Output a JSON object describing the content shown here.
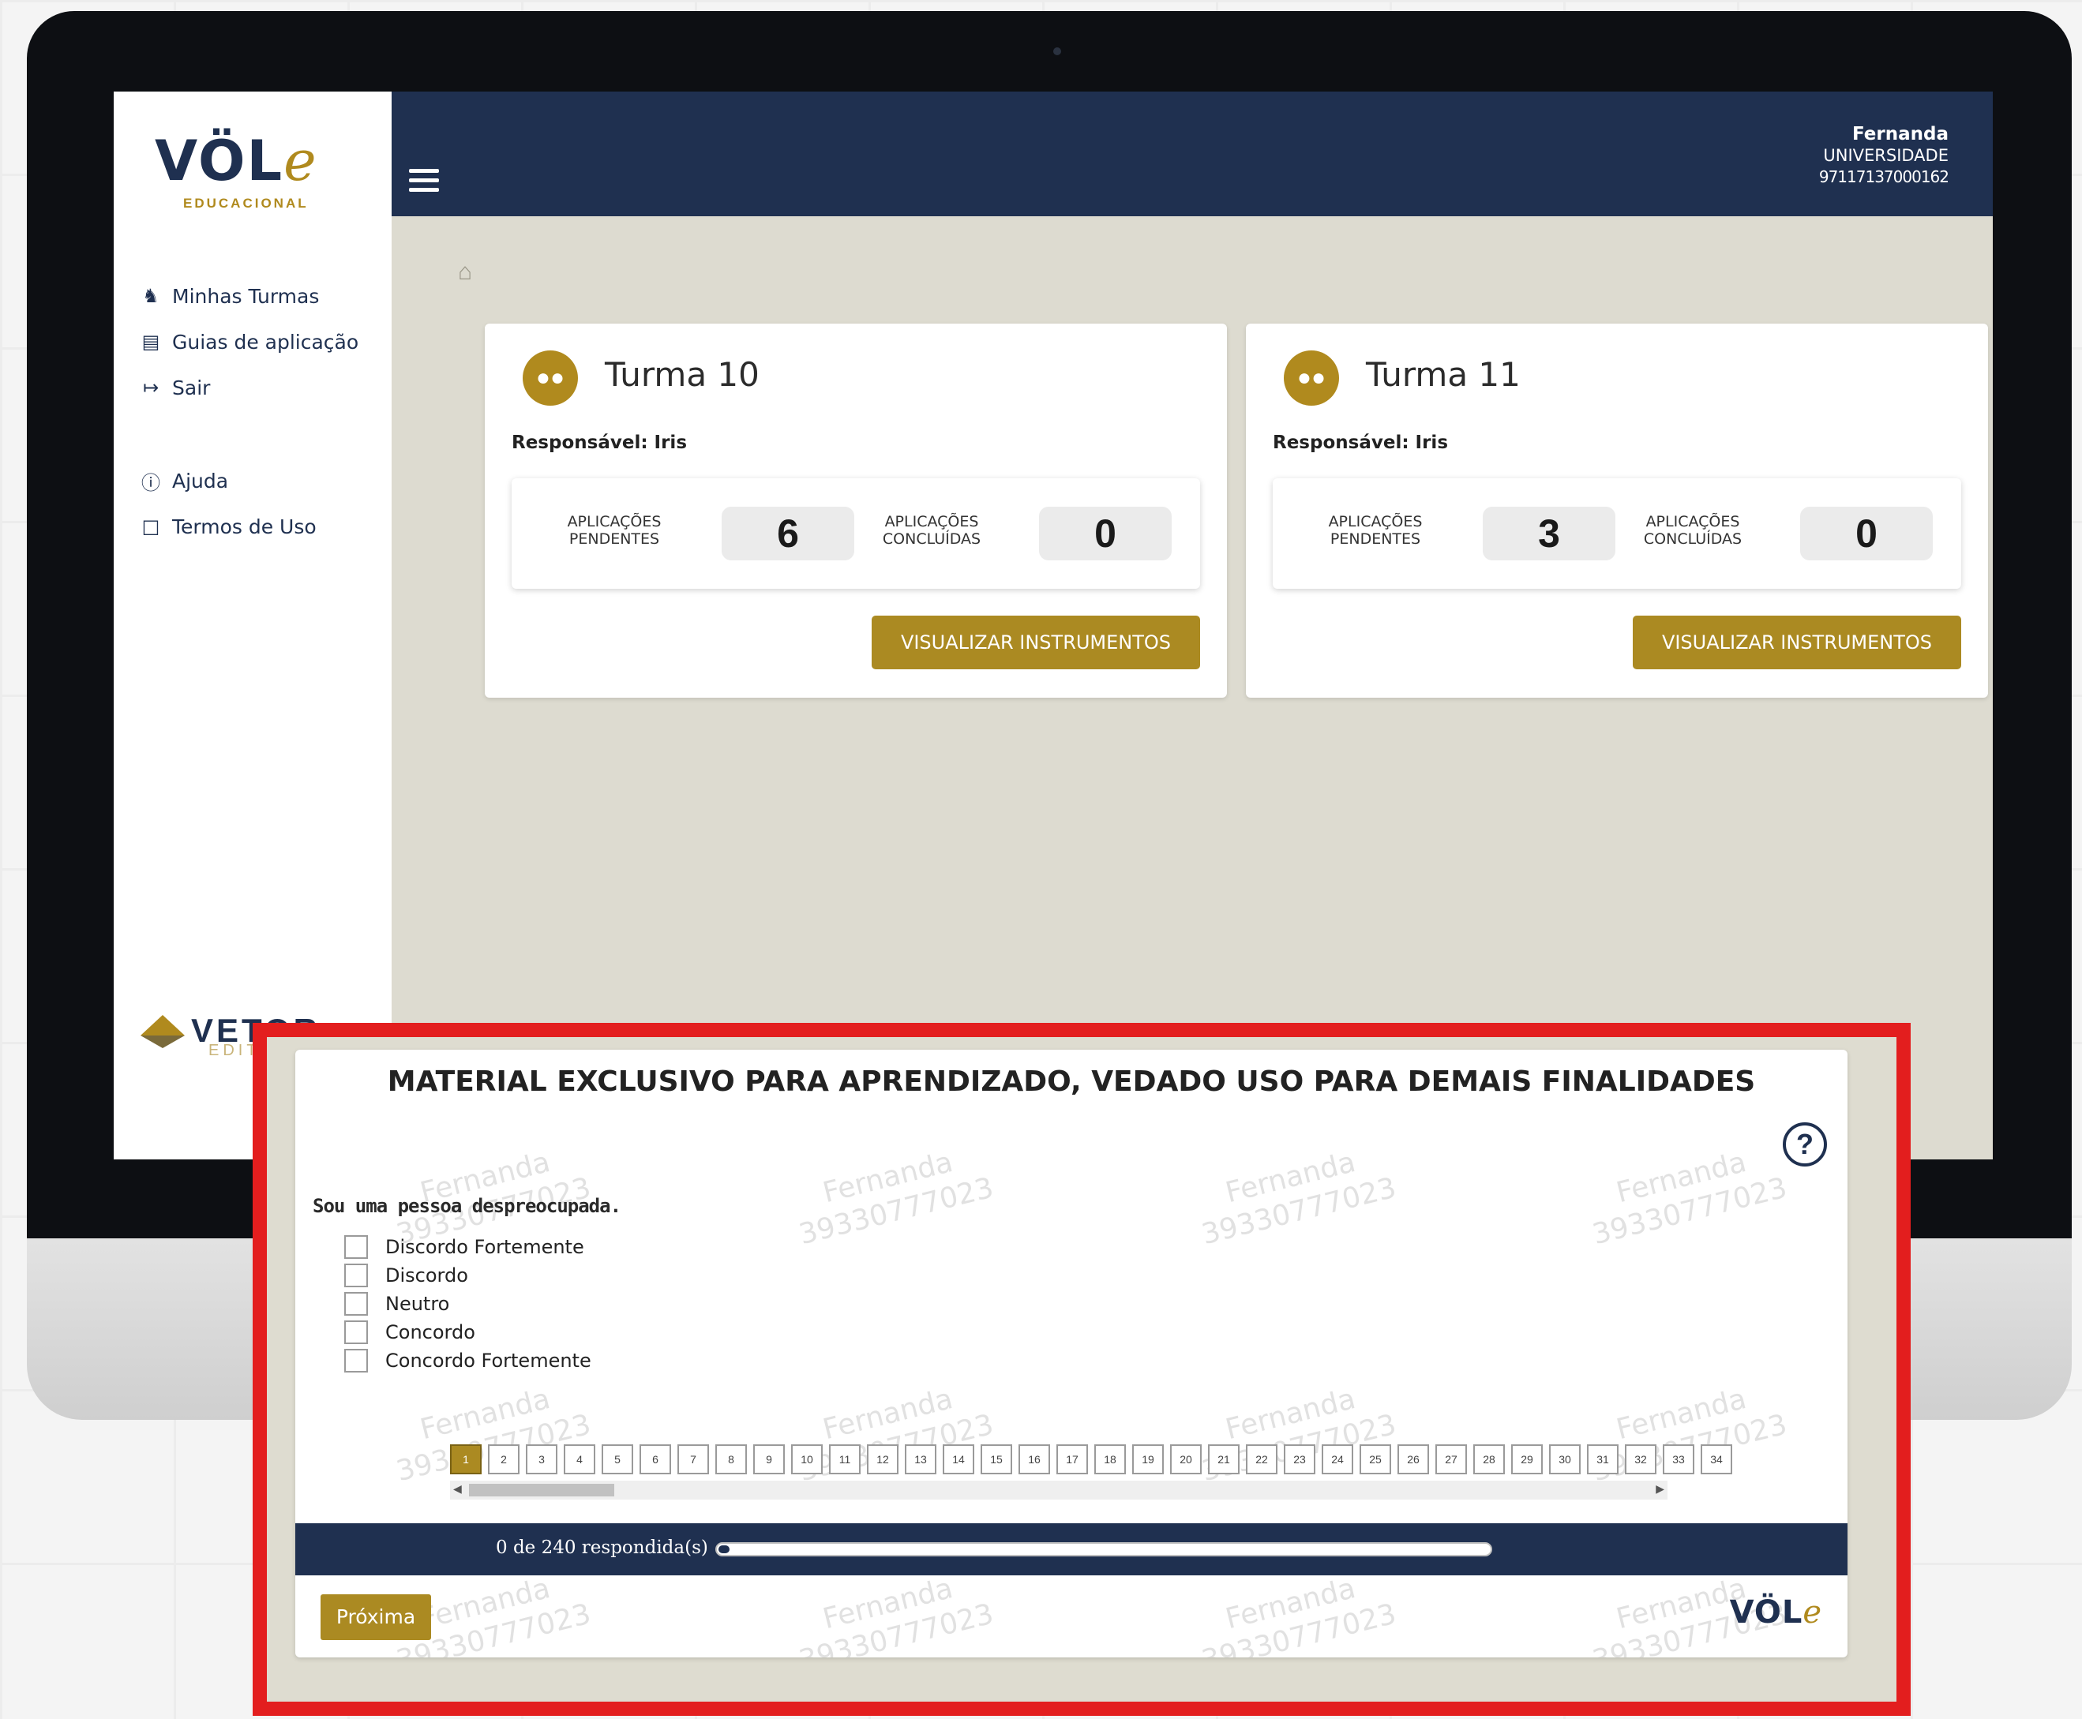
{
  "sidebar": {
    "logo_main": "VÖL",
    "logo_e": "e",
    "logo_sub": "EDUCACIONAL",
    "items": [
      {
        "label": "Minhas Turmas",
        "icon": "users-icon"
      },
      {
        "label": "Guias de aplicação",
        "icon": "archive-icon"
      },
      {
        "label": "Sair",
        "icon": "logout-icon"
      },
      {
        "label": "Ajuda",
        "icon": "help-circle-icon"
      },
      {
        "label": "Termos de Uso",
        "icon": "document-icon"
      }
    ],
    "vetor_text": "VETOR",
    "vetor_sub": "EDIT"
  },
  "header": {
    "user_name": "Fernanda",
    "org": "UNIVERSIDADE",
    "user_id": "97117137000162"
  },
  "cards": [
    {
      "title": "Turma 10",
      "responsible": "Responsável: Iris",
      "pending_label": "Aplicações pendentes",
      "pending_value": "6",
      "done_label": "Aplicações concluídas",
      "done_value": "0",
      "button": "Visualizar instrumentos"
    },
    {
      "title": "Turma 11",
      "responsible": "Responsável: Iris",
      "pending_label": "Aplicações pendentes",
      "pending_value": "3",
      "done_label": "Aplicações concluídas",
      "done_value": "0",
      "button": "Visualizar instrumentos"
    }
  ],
  "overlay": {
    "title": "MATERIAL EXCLUSIVO PARA APRENDIZADO, VEDADO USO PARA DEMAIS FINALIDADES",
    "help": "?",
    "question": "Sou uma pessoa despreocupada.",
    "options": [
      "Discordo Fortemente",
      "Discordo",
      "Neutro",
      "Concordo",
      "Concordo Fortemente"
    ],
    "pages": [
      "1",
      "2",
      "3",
      "4",
      "5",
      "6",
      "7",
      "8",
      "9",
      "10",
      "11",
      "12",
      "13",
      "14",
      "15",
      "16",
      "17",
      "18",
      "19",
      "20",
      "21",
      "22",
      "23",
      "24",
      "25",
      "26",
      "27",
      "28",
      "29",
      "30",
      "31",
      "32",
      "33",
      "34"
    ],
    "active_page": "1",
    "progress_text": "0 de 240 respondida(s)",
    "progress_answered": 0,
    "progress_total": 240,
    "next_button": "Próxima",
    "mini_logo_main": "VÖL",
    "mini_logo_e": "e",
    "watermark_name": "Fernanda",
    "watermark_id": "39330777023"
  },
  "colors": {
    "navy": "#1f3050",
    "gold": "#ab8a22",
    "frame_red": "#e31e1e",
    "content_bg": "#dddbd0"
  }
}
